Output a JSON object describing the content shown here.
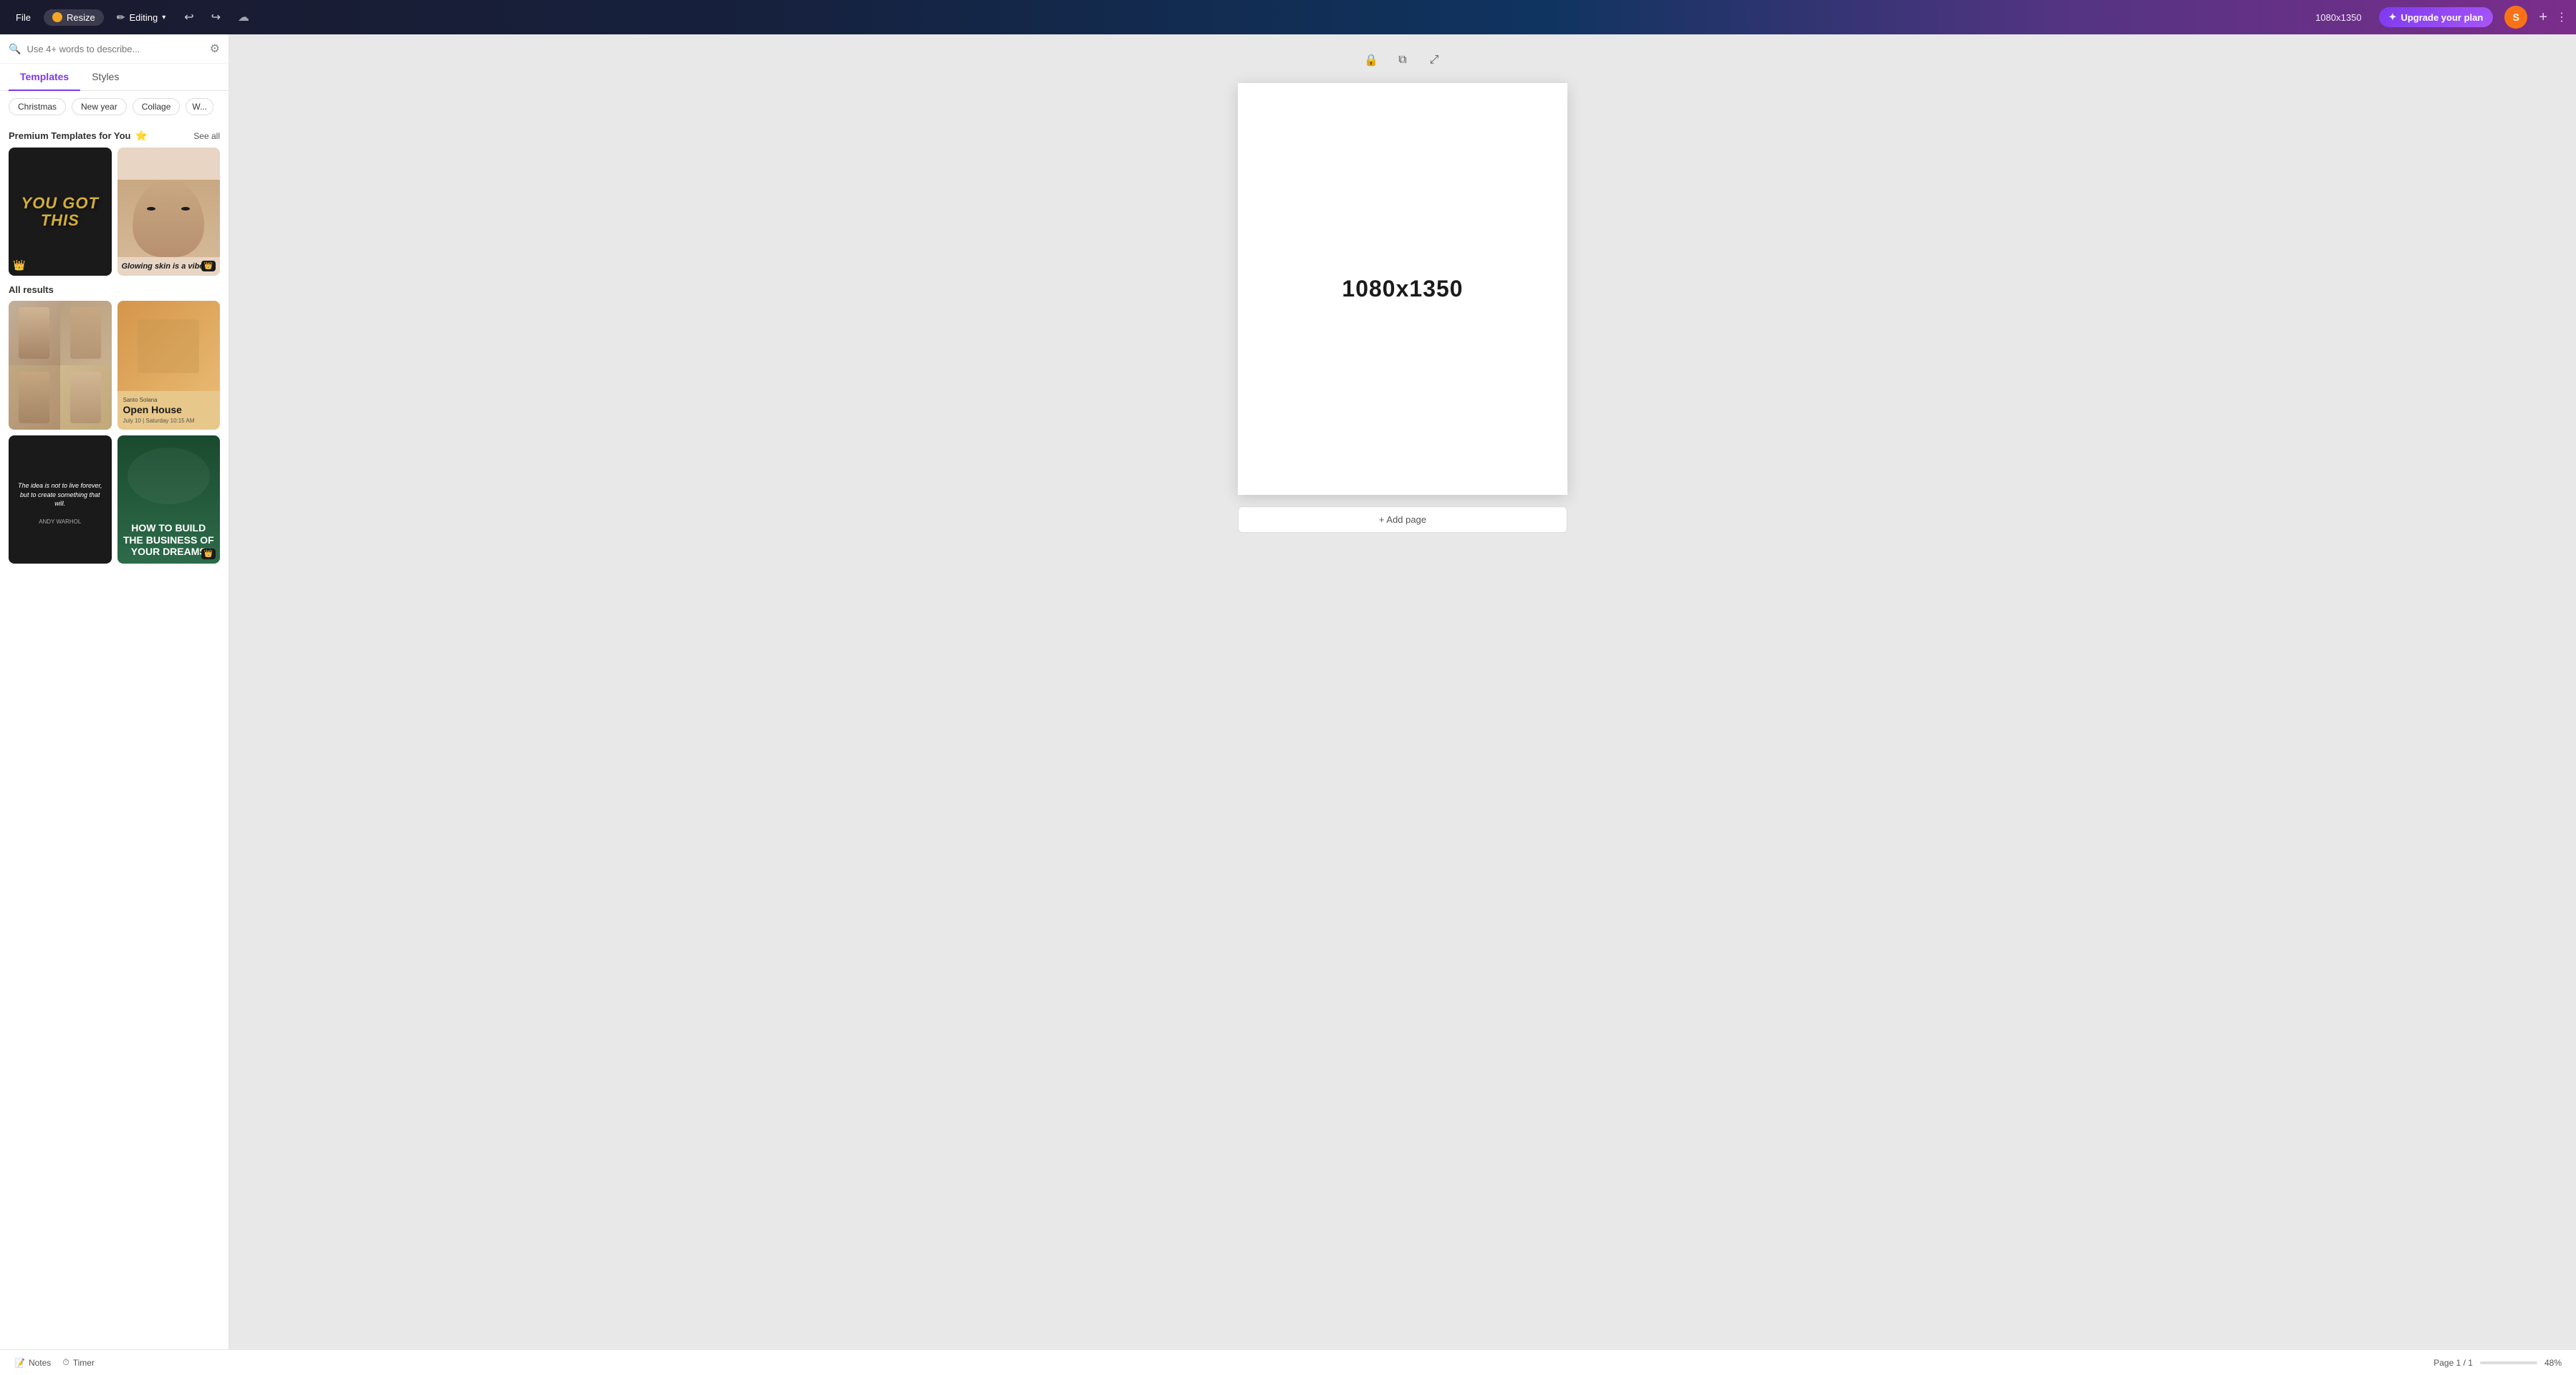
{
  "topbar": {
    "file_label": "File",
    "resize_label": "Resize",
    "editing_label": "Editing",
    "chevron": "▾",
    "undo_icon": "↩",
    "redo_icon": "↪",
    "cloud_icon": "☁",
    "dimensions": "1080x1350",
    "upgrade_label": "Upgrade your plan",
    "upgrade_icon": "✦",
    "avatar_letter": "S",
    "plus_icon": "+",
    "dots_icon": "⋮"
  },
  "sidebar": {
    "search_placeholder": "Use 4+ words to describe...",
    "tabs": [
      {
        "id": "templates",
        "label": "Templates"
      },
      {
        "id": "styles",
        "label": "Styles"
      }
    ],
    "tags": [
      {
        "label": "Christmas"
      },
      {
        "label": "New year"
      },
      {
        "label": "Collage"
      },
      {
        "label": "W..."
      }
    ],
    "premium_section_title": "Premium Templates for You",
    "see_all_label": "See all",
    "all_results_label": "All results",
    "templates": [
      {
        "id": "you-got-this",
        "type": "you-got-this",
        "text": "YOU GOT THIS",
        "premium": true
      },
      {
        "id": "glowing",
        "type": "glowing",
        "text": "Glowing skin is a vibe.",
        "premium": true,
        "crown_right": true
      },
      {
        "id": "collage-fashion",
        "type": "collage-fashion",
        "text": ""
      },
      {
        "id": "open-house",
        "type": "open-house",
        "title": "Open House",
        "subtitle": "Santo Solana"
      },
      {
        "id": "quote-dark",
        "type": "quote-dark",
        "text": "The idea is not to live forever, but to create something that will.",
        "author": "ANDY WARHOL"
      },
      {
        "id": "business",
        "type": "business",
        "text": "HOW TO BUILD THE BUSINESS OF YOUR DREAMS",
        "premium": true
      }
    ]
  },
  "canvas": {
    "size_text": "1080x1350",
    "add_page_label": "+ Add page",
    "lock_icon": "🔒",
    "duplicate_icon": "⧉",
    "expand_icon": "⤢"
  },
  "bottombar": {
    "notes_label": "Notes",
    "timer_label": "Timer",
    "page_info": "Page 1 / 1",
    "zoom_level": "48%"
  }
}
